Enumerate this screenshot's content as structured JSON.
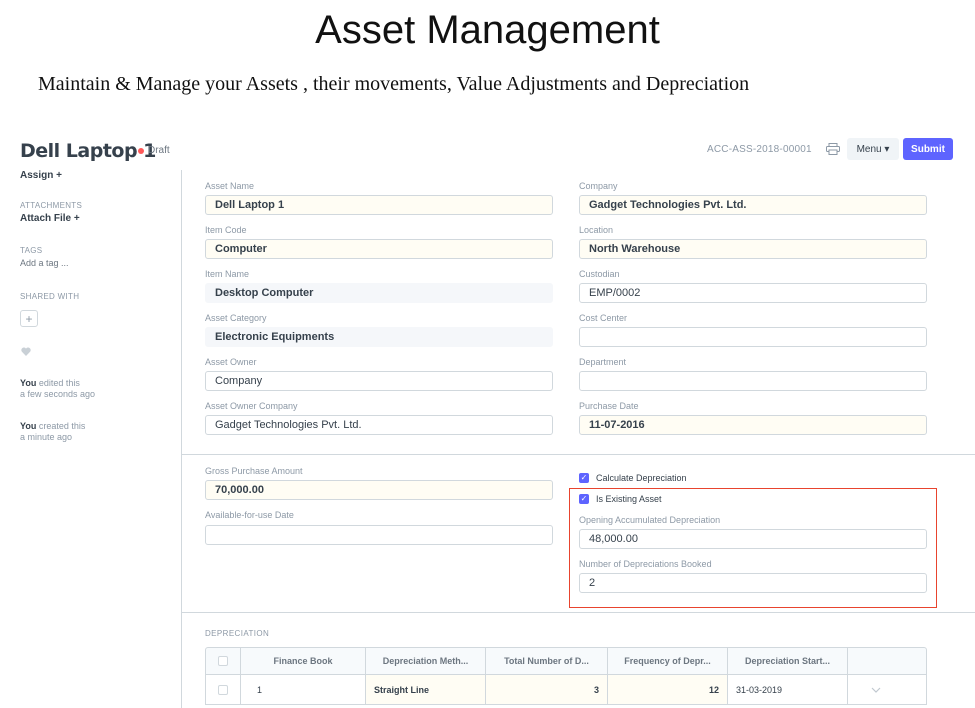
{
  "slide": {
    "title": "Asset Management",
    "subtitle": "Maintain & Manage your Assets , their movements,  Value Adjustments and Depreciation"
  },
  "header": {
    "doc_title": "Dell Laptop 1",
    "status": "Draft",
    "doc_id": "ACC-ASS-2018-00001",
    "menu_label": "Menu ▾",
    "submit_label": "Submit",
    "status_color": "#ff5858",
    "accent": "#5e64ff"
  },
  "sidebar": {
    "assign": "Assign +",
    "attachments_label": "ATTACHMENTS",
    "attach_file": "Attach File +",
    "tags_label": "TAGS",
    "add_tag": "Add a tag ...",
    "shared_label": "SHARED WITH",
    "shared_add": "+",
    "activity": [
      {
        "who": "You",
        "action": " edited this",
        "when": "a few seconds ago"
      },
      {
        "who": "You",
        "action": " created this",
        "when": "a minute ago"
      }
    ]
  },
  "form": {
    "asset_name_label": "Asset Name",
    "asset_name": "Dell Laptop 1",
    "company_label": "Company",
    "company": "Gadget Technologies Pvt. Ltd.",
    "item_code_label": "Item Code",
    "item_code": "Computer",
    "location_label": "Location",
    "location": "North Warehouse",
    "item_name_label": "Item Name",
    "item_name": "Desktop Computer",
    "custodian_label": "Custodian",
    "custodian": "EMP/0002",
    "asset_category_label": "Asset Category",
    "asset_category": "Electronic Equipments",
    "cost_center_label": "Cost Center",
    "cost_center": "",
    "asset_owner_label": "Asset Owner",
    "asset_owner": "Company",
    "department_label": "Department",
    "department": "",
    "asset_owner_company_label": "Asset Owner Company",
    "asset_owner_company": "Gadget Technologies Pvt. Ltd.",
    "purchase_date_label": "Purchase Date",
    "purchase_date": "11-07-2016",
    "gross_purchase_amount_label": "Gross Purchase Amount",
    "gross_purchase_amount": "70,000.00",
    "available_for_use_label": "Available-for-use Date",
    "available_for_use": "",
    "calculate_depreciation_label": "Calculate Depreciation",
    "is_existing_asset_label": "Is Existing Asset",
    "opening_acc_dep_label": "Opening Accumulated Depreciation",
    "opening_acc_dep": "48,000.00",
    "num_dep_booked_label": "Number of Depreciations Booked",
    "num_dep_booked": "2"
  },
  "depreciation": {
    "section_label": "DEPRECIATION",
    "columns": [
      "Finance Book",
      "Depreciation Meth...",
      "Total Number of D...",
      "Frequency of Depr...",
      "Depreciation Start..."
    ],
    "rows": [
      {
        "idx": "1",
        "finance_book": "",
        "method": "Straight Line",
        "total": "3",
        "frequency": "12",
        "start": "31-03-2019"
      }
    ]
  }
}
